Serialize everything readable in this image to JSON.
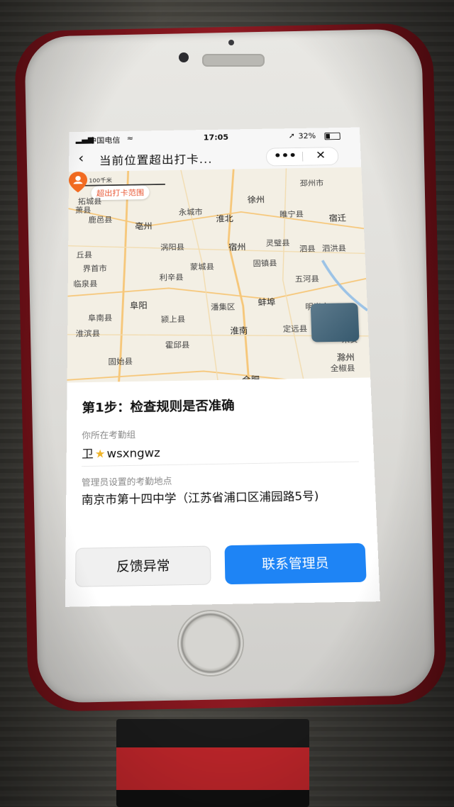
{
  "status_bar": {
    "signal": "▂▄▆",
    "carrier": "中国电信",
    "wifi": "≈",
    "time": "17:05",
    "location_arrow": "➚",
    "battery": "32%"
  },
  "nav": {
    "back_icon": "‹",
    "title": "当前位置超出打卡...",
    "more_icon": "•••",
    "close_icon": "✕"
  },
  "map": {
    "scale_label": "50        100千米",
    "range_chip": "超出打卡范围",
    "cities": [
      {
        "label": "萧县"
      },
      {
        "label": "徐州"
      },
      {
        "label": "邳州市"
      },
      {
        "label": "拓城县"
      },
      {
        "label": "鹿邑县"
      },
      {
        "label": "亳州"
      },
      {
        "label": "永城市"
      },
      {
        "label": "淮北"
      },
      {
        "label": "睢宁县"
      },
      {
        "label": "宿迁"
      },
      {
        "label": "涡阳县"
      },
      {
        "label": "宿州"
      },
      {
        "label": "灵璧县"
      },
      {
        "label": "泗县"
      },
      {
        "label": "泗洪县"
      },
      {
        "label": "丘县"
      },
      {
        "label": "蒙城县"
      },
      {
        "label": "固镇县"
      },
      {
        "label": "界首市"
      },
      {
        "label": "利辛县"
      },
      {
        "label": "五河县"
      },
      {
        "label": "临泉县"
      },
      {
        "label": "阜阳"
      },
      {
        "label": "潘集区"
      },
      {
        "label": "蚌埠"
      },
      {
        "label": "明光市"
      },
      {
        "label": "阜南县"
      },
      {
        "label": "颍上县"
      },
      {
        "label": "淮滨县"
      },
      {
        "label": "淮南"
      },
      {
        "label": "定远县"
      },
      {
        "label": "霍邱县"
      },
      {
        "label": "来安"
      },
      {
        "label": "固始县"
      },
      {
        "label": "滁州"
      },
      {
        "label": "全椒县"
      },
      {
        "label": "合肥"
      }
    ]
  },
  "card": {
    "step_title": "第1步：检查规则是否准确",
    "group_label": "你所在考勤组",
    "group_prefix": "卫",
    "group_star": "★",
    "group_name": "wsxngwz",
    "location_label": "管理员设置的考勤地点",
    "location_value": "南京市第十四中学（江苏省浦口区浦园路5号)",
    "feedback_button": "反馈异常",
    "contact_button": "联系管理员"
  },
  "colors": {
    "accent": "#1e84f5",
    "chip_text": "#e8532f",
    "pin": "#f26b21",
    "phone_case": "#8e1a22"
  }
}
